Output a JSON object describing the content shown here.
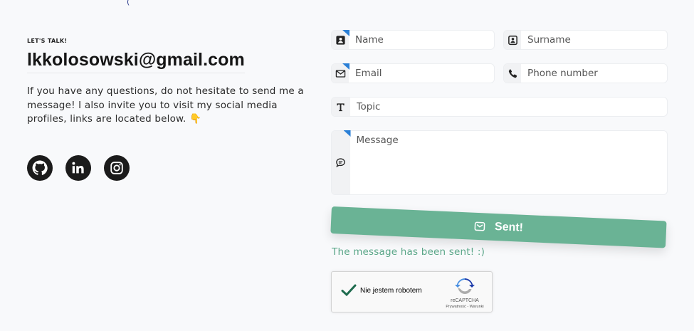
{
  "top_fragment": "(",
  "contact": {
    "eyebrow": "LET'S TALK!",
    "email": "lkkolosowski@gmail.com",
    "intro": "If you have any questions, do not hesitate to send me a message! I also invite you to visit my social media profiles, links are located below.",
    "intro_emoji": "👇",
    "socials": [
      {
        "name": "github",
        "icon": "github-icon"
      },
      {
        "name": "linkedin",
        "icon": "linkedin-icon"
      },
      {
        "name": "instagram",
        "icon": "instagram-icon"
      }
    ]
  },
  "form": {
    "name_placeholder": "Name",
    "surname_placeholder": "Surname",
    "email_placeholder": "Email",
    "phone_placeholder": "Phone number",
    "topic_placeholder": "Topic",
    "message_placeholder": "Message",
    "submit_label": "Sent!",
    "status_message": "The message has been sent! :)"
  },
  "recaptcha": {
    "label": "Nie jestem robotem",
    "brand": "reCAPTCHA",
    "links": "Prywatność - Warunki"
  },
  "colors": {
    "accent": "#6ab395",
    "status_text": "#5aa688",
    "badge": "#2a7fd6",
    "background": "#f8f9fb"
  }
}
